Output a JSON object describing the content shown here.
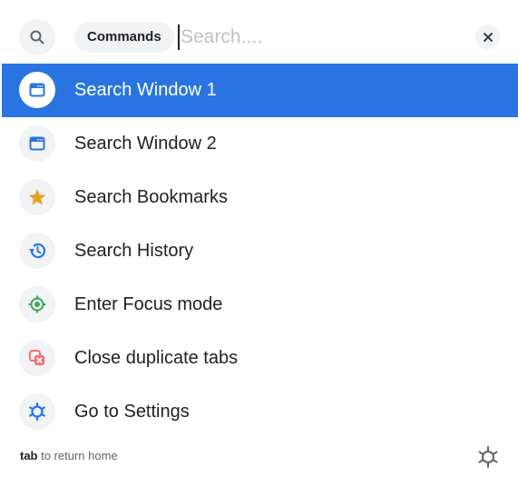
{
  "search": {
    "chip_label": "Commands",
    "placeholder": "Search....",
    "value": ""
  },
  "items": [
    {
      "label": "Search Window 1",
      "icon": "window-icon",
      "selected": true
    },
    {
      "label": "Search Window 2",
      "icon": "window-icon",
      "selected": false
    },
    {
      "label": "Search Bookmarks",
      "icon": "star-icon",
      "selected": false
    },
    {
      "label": "Search History",
      "icon": "history-icon",
      "selected": false
    },
    {
      "label": "Enter Focus mode",
      "icon": "focus-icon",
      "selected": false
    },
    {
      "label": "Close duplicate tabs",
      "icon": "close-duplicates-icon",
      "selected": false
    },
    {
      "label": "Go to Settings",
      "icon": "settings-icon",
      "selected": false
    }
  ],
  "footer": {
    "key": "tab",
    "hint_text": "to return home"
  },
  "colors": {
    "accent": "#2a74e2",
    "star": "#e8a324",
    "focus": "#34a853",
    "close": "#f17171"
  }
}
